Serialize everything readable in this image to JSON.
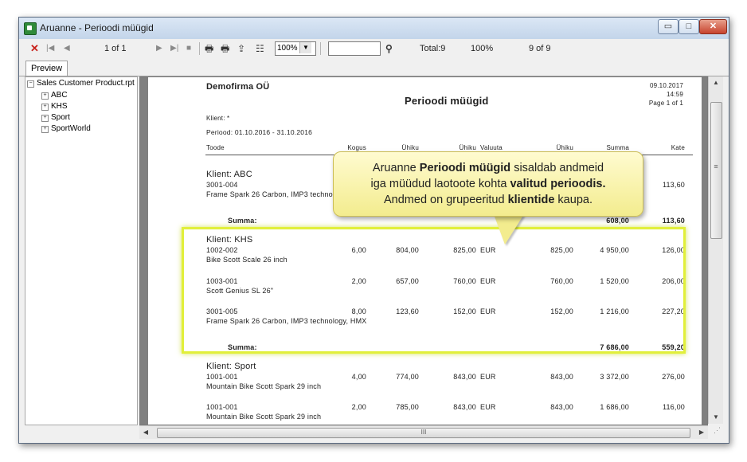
{
  "window": {
    "title": "Aruanne - Perioodi müügid",
    "min_glyph": "▭",
    "max_glyph": "□",
    "close_glyph": "✕"
  },
  "toolbar": {
    "close_glyph": "✕",
    "first_glyph": "|◀",
    "prev_glyph": "◀",
    "page_indicator": "1 of 1",
    "next_glyph": "▶",
    "last_glyph": "▶|",
    "stop_glyph": "■",
    "print_glyph": "🖶",
    "print_setup_glyph": "🖶",
    "export_glyph": "⇪",
    "tree_glyph": "☷",
    "zoom_value": "100%",
    "zoom_arrow": "▼",
    "search_value": "",
    "find_glyph": "⚲",
    "total": "Total:9",
    "percent": "100%",
    "records": "9 of 9"
  },
  "tabs": [
    {
      "label": "Preview"
    }
  ],
  "tree": {
    "root": "Sales Customer Product.rpt",
    "root_toggle": "−",
    "items": [
      {
        "label": "ABC",
        "toggle": "+"
      },
      {
        "label": "KHS",
        "toggle": "+"
      },
      {
        "label": "Sport",
        "toggle": "+"
      },
      {
        "label": "SportWorld",
        "toggle": "+"
      }
    ]
  },
  "report": {
    "company": "Demofirma OÜ",
    "date": "09.10.2017",
    "time": "14:59",
    "page": "Page 1 of 1",
    "title": "Perioodi müügid",
    "client_filter": "Klient: *",
    "period": "Periood: 01.10.2016 - 31.10.2016",
    "columns": [
      "Toode",
      "Kogus",
      "Ühiku",
      "Ühiku",
      "Valuuta",
      "Ühiku",
      "Summa",
      "Kate"
    ],
    "sum_label": "Summa:",
    "groups": [
      {
        "client": "Klient: ABC",
        "rows": [
          {
            "code": "3001-004",
            "name": "Frame Spark 26 Carbon, IMP3 technology, HMX",
            "qty": "",
            "c1": "",
            "c2": "",
            "cur": "",
            "c3": "",
            "sum": "",
            "margin": "113,60"
          }
        ],
        "sum": "608,00",
        "margin": "113,60"
      },
      {
        "client": "Klient: KHS",
        "rows": [
          {
            "code": "1002-002",
            "name": "Bike Scott Scale 26 inch",
            "qty": "6,00",
            "c1": "804,00",
            "c2": "825,00",
            "cur": "EUR",
            "c3": "825,00",
            "sum": "4 950,00",
            "margin": "126,00"
          },
          {
            "code": "1003-001",
            "name": "Scott Genius SL 26\"",
            "qty": "2,00",
            "c1": "657,00",
            "c2": "760,00",
            "cur": "EUR",
            "c3": "760,00",
            "sum": "1 520,00",
            "margin": "206,00"
          },
          {
            "code": "3001-005",
            "name": "Frame Spark 26 Carbon, IMP3 technology, HMX",
            "qty": "8,00",
            "c1": "123,60",
            "c2": "152,00",
            "cur": "EUR",
            "c3": "152,00",
            "sum": "1 216,00",
            "margin": "227,20"
          }
        ],
        "sum": "7 686,00",
        "margin": "559,20"
      },
      {
        "client": "Klient: Sport",
        "rows": [
          {
            "code": "1001-001",
            "name": "Mountain Bike Scott Spark 29 inch",
            "qty": "4,00",
            "c1": "774,00",
            "c2": "843,00",
            "cur": "EUR",
            "c3": "843,00",
            "sum": "3 372,00",
            "margin": "276,00"
          },
          {
            "code": "1001-001",
            "name": "Mountain Bike Scott Spark 29 inch",
            "qty": "2,00",
            "c1": "785,00",
            "c2": "843,00",
            "cur": "EUR",
            "c3": "843,00",
            "sum": "1 686,00",
            "margin": "116,00"
          }
        ]
      }
    ]
  },
  "callout": {
    "l1_a": "Aruanne ",
    "l1_b": "Perioodi müügid",
    "l1_c": " sisaldab andmeid",
    "l2_a": "iga müüdud laotoote kohta ",
    "l2_b": "valitud perioodis.",
    "l3_a": "Andmed on grupeeritud ",
    "l3_b": "klientide",
    "l3_c": " kaupa."
  },
  "scrollbar": {
    "up": "▲",
    "down": "▼",
    "left": "◀",
    "right": "▶",
    "h_grip": "III",
    "v_grip": "≡",
    "corner": "⋰"
  },
  "colors": {
    "highlight": "#e1ef3a",
    "callout_bg": "#f3ec8e",
    "close_red": "#c8201a"
  }
}
